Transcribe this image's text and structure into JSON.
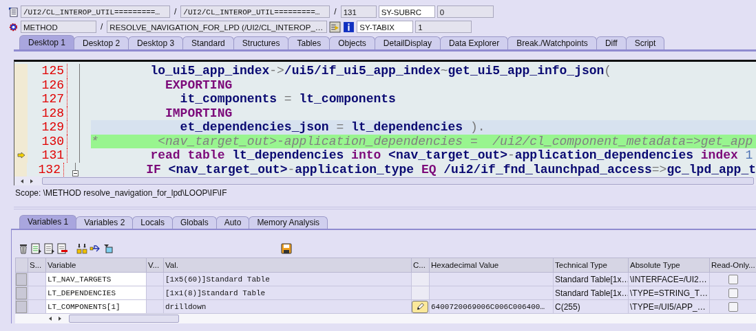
{
  "header": {
    "row_1": {
      "program": "/UI2/CL_INTEROP_UTIL=========…",
      "include": "/UI2/CL_INTEROP_UTIL=========…",
      "line": "131",
      "sys_field": "SY-SUBRC",
      "sys_value": "0",
      "separator_1": "/",
      "separator_2": "/"
    },
    "row_2": {
      "event_type": "METHOD",
      "separator": "/",
      "event": "RESOLVE_NAVIGATION_FOR_LPD (/UI2/CL_INTEROP_…",
      "sys_field": "SY-TABIX",
      "sys_value": "1"
    }
  },
  "tabs": [
    {
      "label": "Desktop 1",
      "selected": true
    },
    {
      "label": "Desktop 2",
      "selected": false
    },
    {
      "label": "Desktop 3",
      "selected": false
    },
    {
      "label": "Standard",
      "selected": false
    },
    {
      "label": "Structures",
      "selected": false
    },
    {
      "label": "Tables",
      "selected": false
    },
    {
      "label": "Objects",
      "selected": false
    },
    {
      "label": "DetailDisplay",
      "selected": false
    },
    {
      "label": "Data Explorer",
      "selected": false
    },
    {
      "label": "Break./Watchpoints",
      "selected": false
    },
    {
      "label": "Diff",
      "selected": false
    },
    {
      "label": "Script",
      "selected": false
    }
  ],
  "code": [
    {
      "number": "125",
      "cursor_line": false,
      "commented": false,
      "current": false,
      "fold": false,
      "segments": [
        {
          "text": "        lo_ui5_app_index",
          "kind": "ident"
        },
        {
          "text": "->",
          "kind": "op"
        },
        {
          "text": "/ui5/if_ui5_app_index",
          "kind": "ident"
        },
        {
          "text": "~",
          "kind": "op"
        },
        {
          "text": "get_ui5_app_info_json",
          "kind": "ident"
        },
        {
          "text": "(",
          "kind": "op"
        }
      ]
    },
    {
      "number": "126",
      "cursor_line": false,
      "commented": false,
      "current": false,
      "fold": false,
      "segments": [
        {
          "text": "          EXPORTING",
          "kind": "keyword"
        }
      ]
    },
    {
      "number": "127",
      "cursor_line": false,
      "commented": false,
      "current": false,
      "fold": false,
      "segments": [
        {
          "text": "            it_components",
          "kind": "ident"
        },
        {
          "text": " = ",
          "kind": "op"
        },
        {
          "text": "lt_components",
          "kind": "ident"
        }
      ]
    },
    {
      "number": "128",
      "cursor_line": false,
      "commented": false,
      "current": false,
      "fold": false,
      "segments": [
        {
          "text": "          IMPORTING",
          "kind": "keyword"
        }
      ]
    },
    {
      "number": "129",
      "cursor_line": true,
      "commented": false,
      "current": false,
      "fold": false,
      "segments": [
        {
          "text": "            et_dependencies_json",
          "kind": "ident"
        },
        {
          "text": " = ",
          "kind": "op"
        },
        {
          "text": "lt_dependencies",
          "kind": "ident"
        },
        {
          "text": " ).",
          "kind": "op"
        }
      ]
    },
    {
      "number": "130",
      "cursor_line": false,
      "commented": true,
      "current": false,
      "fold": false,
      "segments": [
        {
          "text": "*        <nav_target_out>-application_dependencies =  /ui2/cl_component_metadata=>get_app",
          "kind": "comment"
        }
      ]
    },
    {
      "number": "131",
      "cursor_line": false,
      "commented": false,
      "current": true,
      "fold": false,
      "segments": [
        {
          "text": "        read table",
          "kind": "keyword"
        },
        {
          "text": " lt_dependencies ",
          "kind": "ident"
        },
        {
          "text": "into",
          "kind": "keyword"
        },
        {
          "text": " <nav_target_out>",
          "kind": "ident"
        },
        {
          "text": "-",
          "kind": "op"
        },
        {
          "text": "application_dependencies ",
          "kind": "ident"
        },
        {
          "text": "index",
          "kind": "keyword"
        },
        {
          "text": " 1",
          "kind": "number"
        }
      ]
    },
    {
      "number": "132",
      "cursor_line": false,
      "commented": false,
      "current": false,
      "fold": true,
      "segments": [
        {
          "text": "        IF",
          "kind": "keyword"
        },
        {
          "text": " <nav_target_out>",
          "kind": "ident"
        },
        {
          "text": "-",
          "kind": "op"
        },
        {
          "text": "application_type ",
          "kind": "ident"
        },
        {
          "text": "EQ",
          "kind": "keyword"
        },
        {
          "text": " /ui2/if_fnd_launchpad_access",
          "kind": "ident"
        },
        {
          "text": "=>",
          "kind": "op"
        },
        {
          "text": "gc_lpd_app_t",
          "kind": "ident"
        }
      ]
    }
  ],
  "scope": "Scope: \\METHOD resolve_navigation_for_lpd\\LOOP\\IF\\IF",
  "variable_tabs": [
    {
      "label": "Variables 1",
      "selected": true
    },
    {
      "label": "Variables 2",
      "selected": false
    },
    {
      "label": "Locals",
      "selected": false
    },
    {
      "label": "Globals",
      "selected": false
    },
    {
      "label": "Auto",
      "selected": false
    },
    {
      "label": "Memory Analysis",
      "selected": false
    }
  ],
  "table": {
    "columns": [
      "S...",
      "Variable",
      "V...",
      "Val.",
      "C...",
      "Hexadecimal Value",
      "Technical Type",
      "Absolute Type",
      "Read-Only..."
    ],
    "rows": [
      {
        "variable": "LT_NAV_TARGETS",
        "value": "[1x5(60)]Standard Table",
        "editable": false,
        "hex": "",
        "technical_type": "Standard Table[1x…",
        "absolute_type": "\\INTERFACE=/UI2…",
        "read_only": false
      },
      {
        "variable": "LT_DEPENDENCIES",
        "value": "[1x1(8)]Standard Table",
        "editable": false,
        "hex": "",
        "technical_type": "Standard Table[1x…",
        "absolute_type": "\\TYPE=STRING_T…",
        "read_only": false
      },
      {
        "variable": "LT_COMPONENTS[1]",
        "value": "drilldown",
        "editable": true,
        "hex": "6400720069006C006C006400…",
        "technical_type": "C(255)",
        "absolute_type": "\\TYPE=/UI5/APP_…",
        "read_only": false
      }
    ]
  }
}
